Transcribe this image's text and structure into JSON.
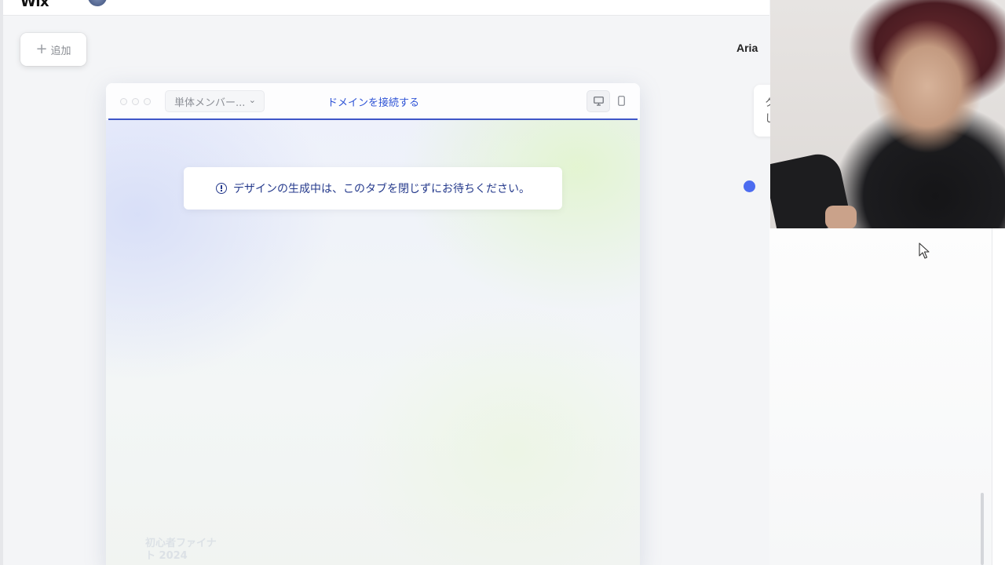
{
  "topbar": {
    "logo_text": "Wix"
  },
  "toolbar": {
    "add_label": "追加"
  },
  "header": {
    "user_name": "Aria"
  },
  "preview": {
    "page_select_value": "単体メンバー...",
    "connect_domain_label": "ドメインを接続する",
    "notice_text": "デザインの生成中は、このタブを閉じずにお待ちください。",
    "ghost_title_lines": [
      "初心者ファイナ",
      "ト 2024"
    ]
  },
  "chat": {
    "bubble_text": "ク\nし"
  },
  "colors": {
    "accent": "#2f54d6",
    "notice_text": "#253a8c",
    "dot": "#4c6cf0"
  }
}
